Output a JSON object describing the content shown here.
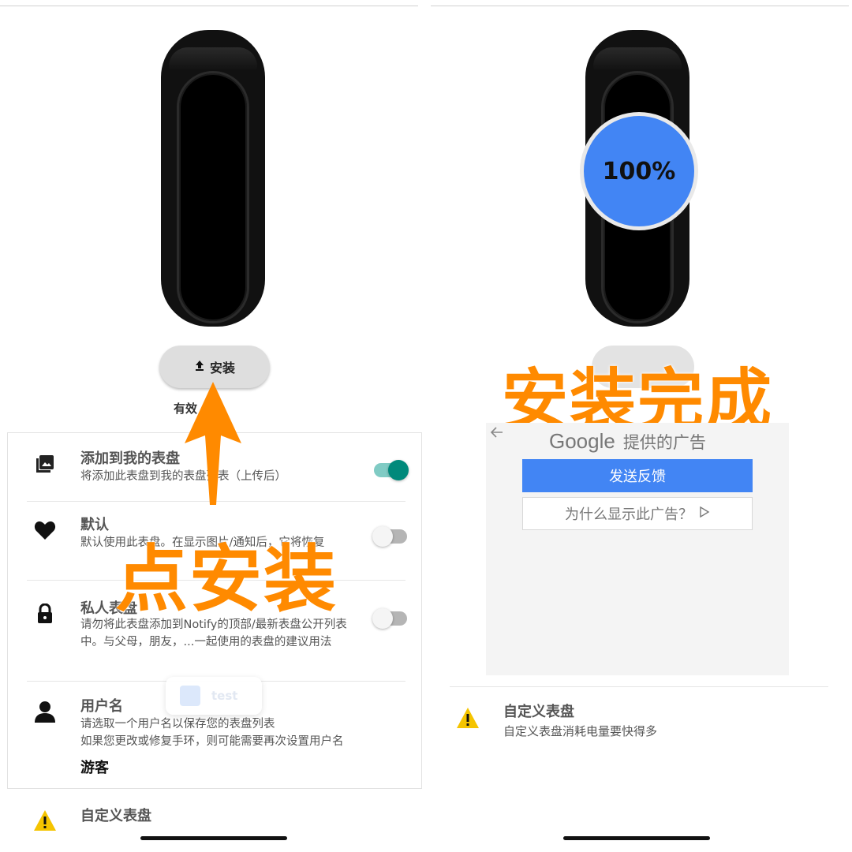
{
  "left": {
    "install_button": {
      "label": "安装",
      "icon": "upload-icon"
    },
    "valid_text": "有效",
    "settings": [
      {
        "title": "添加到我的表盘",
        "desc": "将添加此表盘到我的表盘列表（上传后）",
        "icon": "gallery-icon",
        "toggle": true
      },
      {
        "title": "默认",
        "desc": "默认使用此表盘。在显示图片/通知后，它将恢复",
        "icon": "heart-icon",
        "toggle": false
      },
      {
        "title": "私人表盘",
        "desc": "请勿将此表盘添加到Notify的顶部/最新表盘公开列表中。与父母，朋友，...一起使用的表盘的建议用法",
        "icon": "lock-icon",
        "toggle": false
      },
      {
        "title": "用户名",
        "desc": "请选取一个用户名以保存您的表盘列表\n如果您更改或修复手环，则可能需要再次设置用户名",
        "icon": "person-icon",
        "value": "游客"
      }
    ],
    "float_chip": "test",
    "bottom_title": "自定义表盘",
    "overlay": "点安装"
  },
  "right": {
    "progress": "100%",
    "overlay": "安装完成",
    "ad": {
      "google": "Google",
      "provided": "提供的广告",
      "feedback": "发送反馈",
      "why": "为什么显示此广告？"
    },
    "custom": {
      "title": "自定义表盘",
      "desc": "自定义表盘消耗电量要快得多"
    }
  },
  "colors": {
    "accent": "#ff8a00",
    "blue": "#4285f4",
    "teal": "#00897b"
  }
}
